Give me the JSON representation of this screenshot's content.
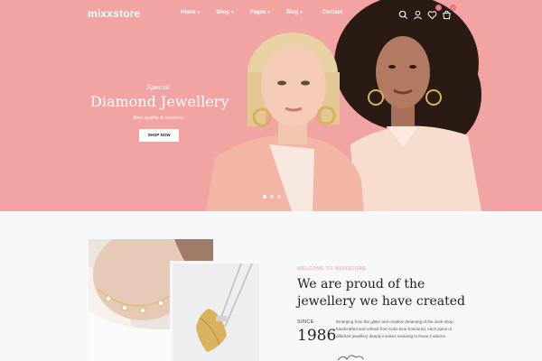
{
  "header": {
    "logo": "mixxstore",
    "nav": [
      {
        "label": "Home",
        "has_caret": true
      },
      {
        "label": "Shop",
        "has_caret": true
      },
      {
        "label": "Pages",
        "has_caret": true
      },
      {
        "label": "Blog",
        "has_caret": true
      },
      {
        "label": "Contact",
        "has_caret": false
      }
    ],
    "icons": [
      "search-icon",
      "user-icon",
      "heart-icon",
      "cart-icon"
    ],
    "wishlist_count": "0",
    "cart_count": "0",
    "caret_glyph": "▾"
  },
  "hero": {
    "kicker": "Special",
    "title": "Diamond Jewellery",
    "subtitle": "Best quality & services",
    "cta": "SHOP NOW",
    "slides": 3,
    "active_slide": 0,
    "bg_color": "#f2a4a3"
  },
  "about": {
    "eyebrow": "WELCOME TO MIXXSTORE",
    "title_line1": "We are proud of the",
    "title_line2": "jewellery we have created",
    "since_label": "SINCE",
    "year": "1986",
    "text": "Emerging from the glitter and creative dreaming of the work-shop, handcrafted and refined from tools time-honoured, each piece of affarhart jewellery deeply invokes meaning to those it adorns.",
    "accent_color": "#e4949c"
  }
}
